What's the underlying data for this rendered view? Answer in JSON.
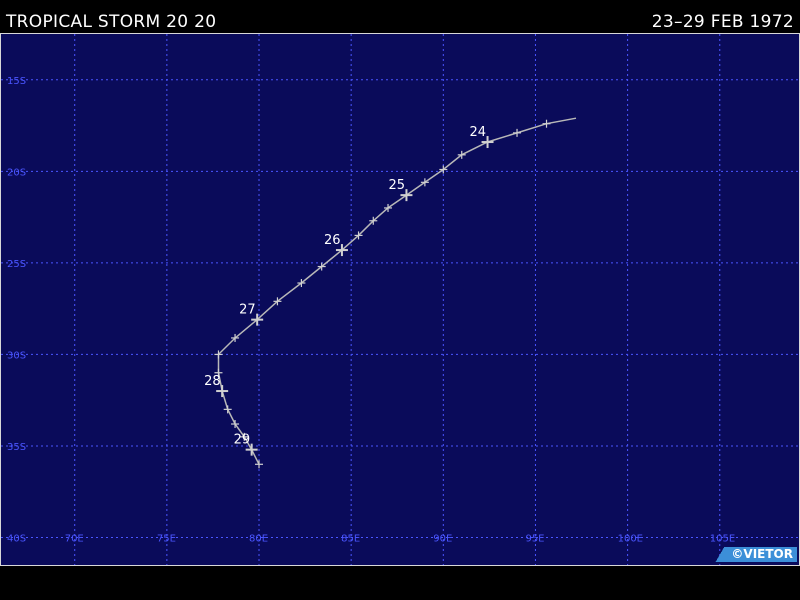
{
  "header": {
    "title": "TROPICAL STORM 20 20",
    "date_range": "23–29 FEB 1972"
  },
  "map": {
    "background_color": "#0a0b5a",
    "grid_color": "#4a55ff",
    "track_color": "#b8b8b8",
    "lat_labels": [
      "15S",
      "20S",
      "25S",
      "30S",
      "35S",
      "40S"
    ],
    "lat_values": [
      -15,
      -20,
      -25,
      -30,
      -35,
      -40
    ],
    "lon_labels": [
      "70E",
      "75E",
      "80E",
      "85E",
      "90E",
      "95E",
      "100E",
      "105E"
    ],
    "lon_values": [
      70,
      75,
      80,
      85,
      90,
      95,
      100,
      105
    ],
    "extent": {
      "lon_min": 66,
      "lon_max": 109.3,
      "lat_max": -12.5,
      "lat_min": -41.5
    },
    "track": [
      {
        "lon": 97.2,
        "lat": -17.1
      },
      {
        "lon": 95.6,
        "lat": -17.4
      },
      {
        "lon": 94.0,
        "lat": -17.9
      },
      {
        "lon": 92.4,
        "lat": -18.4,
        "label": "24"
      },
      {
        "lon": 91.0,
        "lat": -19.1
      },
      {
        "lon": 90.0,
        "lat": -19.9
      },
      {
        "lon": 89.0,
        "lat": -20.6
      },
      {
        "lon": 88.0,
        "lat": -21.3,
        "label": "25"
      },
      {
        "lon": 87.0,
        "lat": -22.0
      },
      {
        "lon": 86.2,
        "lat": -22.7
      },
      {
        "lon": 85.4,
        "lat": -23.5
      },
      {
        "lon": 84.5,
        "lat": -24.3,
        "label": "26"
      },
      {
        "lon": 83.4,
        "lat": -25.2
      },
      {
        "lon": 82.3,
        "lat": -26.1
      },
      {
        "lon": 81.0,
        "lat": -27.1
      },
      {
        "lon": 79.9,
        "lat": -28.1,
        "label": "27"
      },
      {
        "lon": 78.7,
        "lat": -29.1
      },
      {
        "lon": 77.8,
        "lat": -30.0
      },
      {
        "lon": 77.8,
        "lat": -31.0
      },
      {
        "lon": 78.0,
        "lat": -32.0,
        "label": "28"
      },
      {
        "lon": 78.3,
        "lat": -33.0
      },
      {
        "lon": 78.7,
        "lat": -33.8
      },
      {
        "lon": 79.2,
        "lat": -34.5
      },
      {
        "lon": 79.6,
        "lat": -35.2,
        "label": "29"
      },
      {
        "lon": 80.0,
        "lat": -36.0
      }
    ]
  },
  "credit": "©VIETOR"
}
